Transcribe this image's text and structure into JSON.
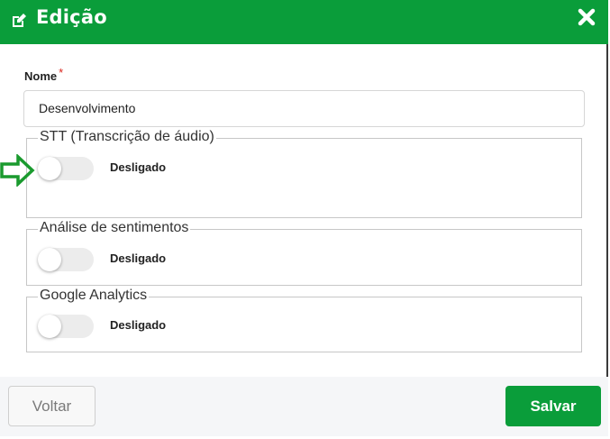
{
  "header": {
    "title": "Edição",
    "icon": "edit-icon",
    "close_icon": "close-icon",
    "background": "#0a9d3a"
  },
  "form": {
    "name_label": "Nome",
    "required_mark": "*",
    "name_value": "Desenvolvimento",
    "sections": [
      {
        "legend": "STT (Transcrição de áudio)",
        "toggle_on": false,
        "status": "Desligado"
      },
      {
        "legend": "Análise de sentimentos",
        "toggle_on": false,
        "status": "Desligado"
      },
      {
        "legend": "Google Analytics",
        "toggle_on": false,
        "status": "Desligado"
      }
    ]
  },
  "annotation": {
    "icon": "arrow-right-outline-icon",
    "color": "#1a9a2e"
  },
  "footer": {
    "back_label": "Voltar",
    "save_label": "Salvar"
  }
}
